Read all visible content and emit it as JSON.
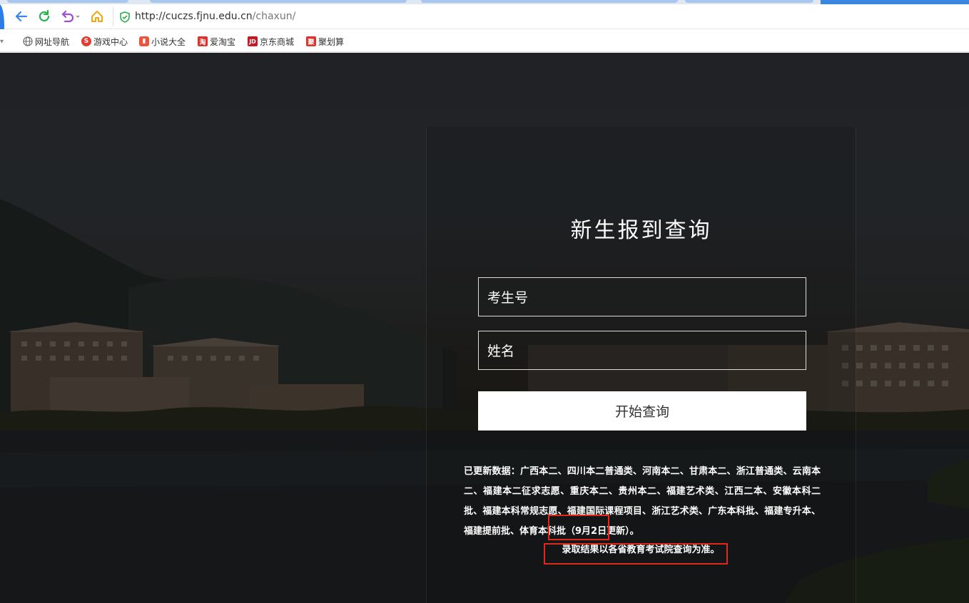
{
  "browser": {
    "url_host": "http://cuczs.fjnu.edu.cn",
    "url_path": "/chaxun/"
  },
  "bookmarks": [
    {
      "label": "网址导航",
      "icon": "globe-icon",
      "color": "#666666"
    },
    {
      "label": "游戏中心",
      "icon": "game-icon",
      "color": "#e03c2f"
    },
    {
      "label": "小说大全",
      "icon": "book-icon",
      "color": "#f0533a"
    },
    {
      "label": "爱淘宝",
      "icon": "taobao-icon",
      "color": "#e2302b"
    },
    {
      "label": "京东商城",
      "icon": "jd-icon",
      "color": "#c81623"
    },
    {
      "label": "聚划算",
      "icon": "juhuasuan-icon",
      "color": "#e2302b"
    }
  ],
  "form": {
    "title": "新生报到查询",
    "exam_no_placeholder": "考生号",
    "name_placeholder": "姓名",
    "submit_label": "开始查询"
  },
  "notice": {
    "part1": "已更新数据：广西本二、四川本二普通类、河南本二、甘肃本二、浙江普通类、云南本二、福建本二征求志愿、重庆本二、贵州本二、福建艺术类、江西二本、安徽本科二批、福建本科常规志愿、福建国际课程项目、浙江艺术类、广东本科批、",
    "highlight": "福建专升本",
    "part2": "、福建提前批、体育本科批（9月2日更新）。",
    "footer": "录取结果以各省教育考试院查询为准。"
  },
  "colors": {
    "accent": "#2b7de9",
    "highlight_box": "#e0281b"
  }
}
